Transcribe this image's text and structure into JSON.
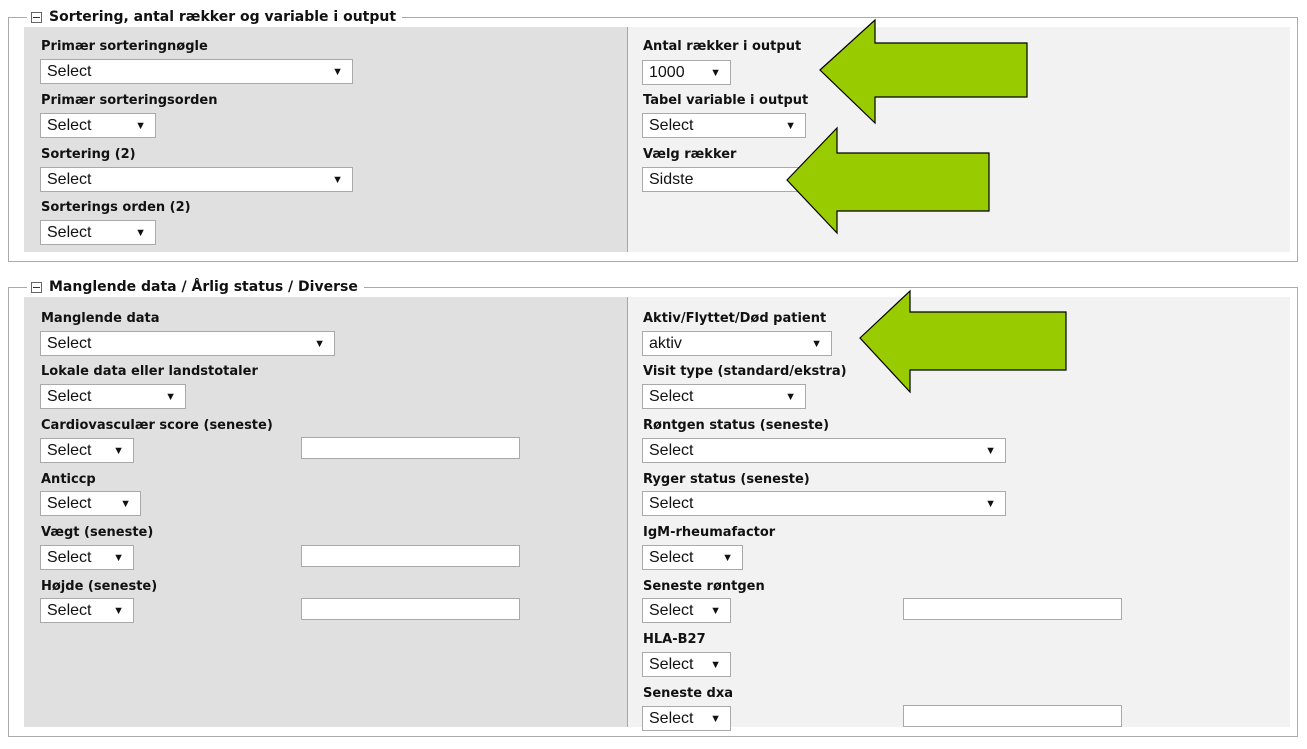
{
  "section1": {
    "title": "Sortering, antal rækker og variable i output",
    "left": {
      "primary_sort_key": {
        "label": "Primær sorteringnøgle",
        "value": "Select"
      },
      "primary_sort_order": {
        "label": "Primær sorteringsorden",
        "value": "Select"
      },
      "sort2": {
        "label": "Sortering (2)",
        "value": "Select"
      },
      "sort_order2": {
        "label": "Sorterings orden (2)",
        "value": "Select"
      }
    },
    "right": {
      "rows_output": {
        "label": "Antal rækker i output",
        "value": "1000"
      },
      "table_vars": {
        "label": "Tabel variable i output",
        "value": "Select"
      },
      "choose_rows": {
        "label": "Vælg rækker",
        "value": "Sidste"
      }
    }
  },
  "section2": {
    "title": "Manglende data / Årlig status / Diverse",
    "left": {
      "missing_data": {
        "label": "Manglende data",
        "value": "Select"
      },
      "local_data": {
        "label": "Lokale data eller landstotaler",
        "value": "Select"
      },
      "cardio_score": {
        "label": "Cardiovasculær score (seneste)",
        "value": "Select"
      },
      "anticcp": {
        "label": "Anticcp",
        "value": "Select"
      },
      "weight": {
        "label": "Vægt (seneste)",
        "value": "Select"
      },
      "height": {
        "label": "Højde (seneste)",
        "value": "Select"
      }
    },
    "right": {
      "patient_status": {
        "label": "Aktiv/Flyttet/Død patient",
        "value": "aktiv"
      },
      "visit_type": {
        "label": "Visit type (standard/ekstra)",
        "value": "Select"
      },
      "xray_status": {
        "label": "Røntgen status (seneste)",
        "value": "Select"
      },
      "smoker_status": {
        "label": "Ryger status (seneste)",
        "value": "Select"
      },
      "igm": {
        "label": "IgM-rheumafactor",
        "value": "Select"
      },
      "latest_xray": {
        "label": "Seneste røntgen",
        "value": "Select"
      },
      "hla_b27": {
        "label": "HLA-B27",
        "value": "Select"
      },
      "latest_dxa": {
        "label": "Seneste dxa",
        "value": "Select"
      }
    }
  },
  "icons": {
    "collapse": "collapse-icon",
    "dropdown": "chevron-down-icon",
    "annotation": "green-arrow-icon"
  },
  "colors": {
    "annotation_arrow": "#99cc00",
    "left_panel": "#e0e0e0",
    "right_panel": "#f2f2f2"
  }
}
